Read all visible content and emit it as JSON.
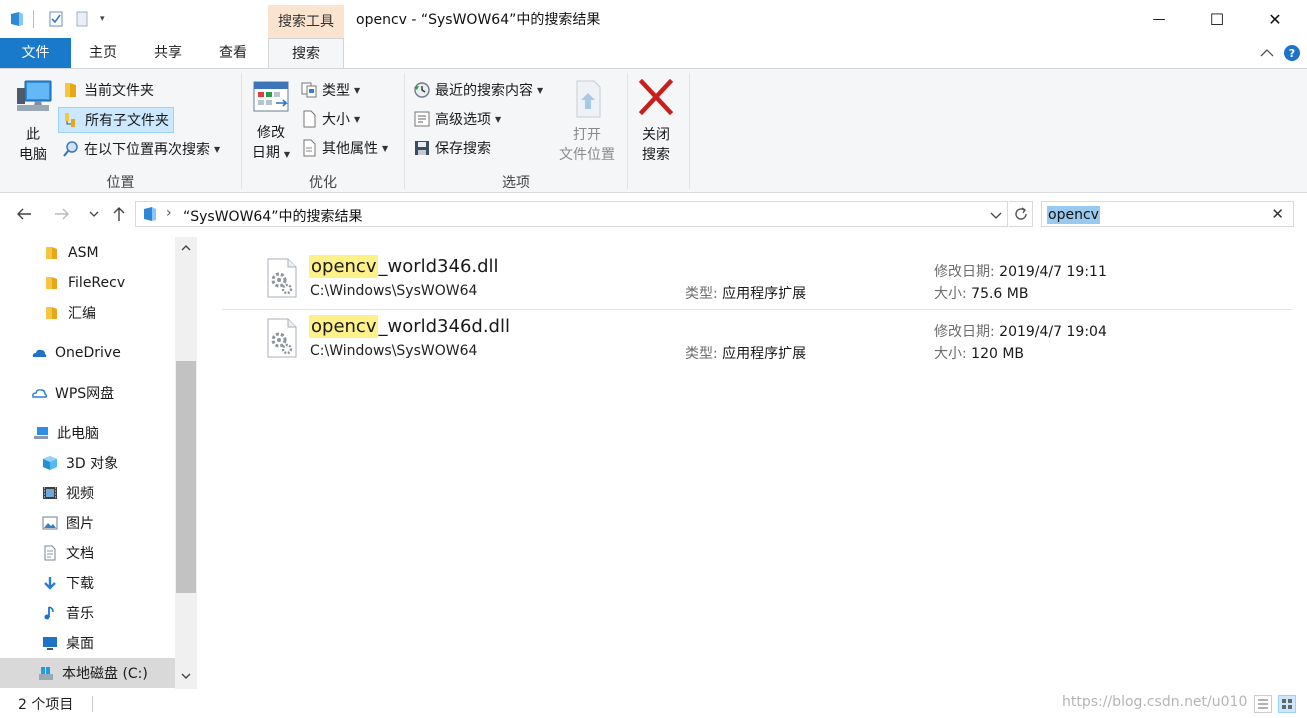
{
  "window": {
    "context_tab": "搜索工具",
    "title": "opencv - “SysWOW64”中的搜索结果",
    "minimize_glyph": "—",
    "maximize_glyph": "☐",
    "close_glyph": "✕"
  },
  "ribbon_tabs": {
    "file": "文件",
    "home": "主页",
    "share": "共享",
    "view": "查看",
    "search": "搜索"
  },
  "ribbon": {
    "this_pc_line1": "此",
    "this_pc_line2": "电脑",
    "current_folder": "当前文件夹",
    "all_subfolders": "所有子文件夹",
    "search_again_in": "在以下位置再次搜索",
    "group_location": "位置",
    "date_modified_line1": "修改",
    "date_modified_line2": "日期",
    "kind": "类型",
    "size": "大小",
    "other_properties": "其他属性",
    "group_refine": "优化",
    "recent_searches": "最近的搜索内容",
    "advanced_options": "高级选项",
    "save_search": "保存搜索",
    "open_location_line1": "打开",
    "open_location_line2": "文件位置",
    "group_options": "选项",
    "close_search_line1": "关闭",
    "close_search_line2": "搜索"
  },
  "address": {
    "separator": "›",
    "path": "“SysWOW64”中的搜索结果"
  },
  "search": {
    "value": "opencv"
  },
  "nav_pane": {
    "items": [
      {
        "label": "ASM",
        "icon": "folder-icon"
      },
      {
        "label": "FileRecv",
        "icon": "folder-icon"
      },
      {
        "label": "汇编",
        "icon": "folder-icon"
      },
      {
        "label": "OneDrive",
        "icon": "onedrive-icon"
      },
      {
        "label": "WPS网盘",
        "icon": "cloud-icon"
      },
      {
        "label": "此电脑",
        "icon": "computer-icon"
      },
      {
        "label": "3D 对象",
        "icon": "cube-icon"
      },
      {
        "label": "视频",
        "icon": "video-icon"
      },
      {
        "label": "图片",
        "icon": "picture-icon"
      },
      {
        "label": "文档",
        "icon": "document-icon"
      },
      {
        "label": "下载",
        "icon": "download-icon"
      },
      {
        "label": "音乐",
        "icon": "music-icon"
      },
      {
        "label": "桌面",
        "icon": "desktop-icon"
      },
      {
        "label": "本地磁盘 (C:)",
        "icon": "drive-icon"
      }
    ]
  },
  "results": [
    {
      "highlight": "opencv",
      "rest": "_world346.dll",
      "path": "C:\\Windows\\SysWOW64",
      "type_label": "类型: ",
      "type_value": "应用程序扩展",
      "date_label": "修改日期: ",
      "date_value": "2019/4/7 19:11",
      "size_label": "大小: ",
      "size_value": "75.6 MB"
    },
    {
      "highlight": "opencv",
      "rest": "_world346d.dll",
      "path": "C:\\Windows\\SysWOW64",
      "type_label": "类型: ",
      "type_value": "应用程序扩展",
      "date_label": "修改日期: ",
      "date_value": "2019/4/7 19:04",
      "size_label": "大小: ",
      "size_value": "120 MB"
    }
  ],
  "status": {
    "count": "2 个项目",
    "watermark": "https://blog.csdn.net/u010"
  },
  "colors": {
    "file_tab": "#1979ca",
    "context_tab": "#fbe4cf",
    "search_highlight": "#fff18a",
    "selection": "#cce8ff"
  }
}
